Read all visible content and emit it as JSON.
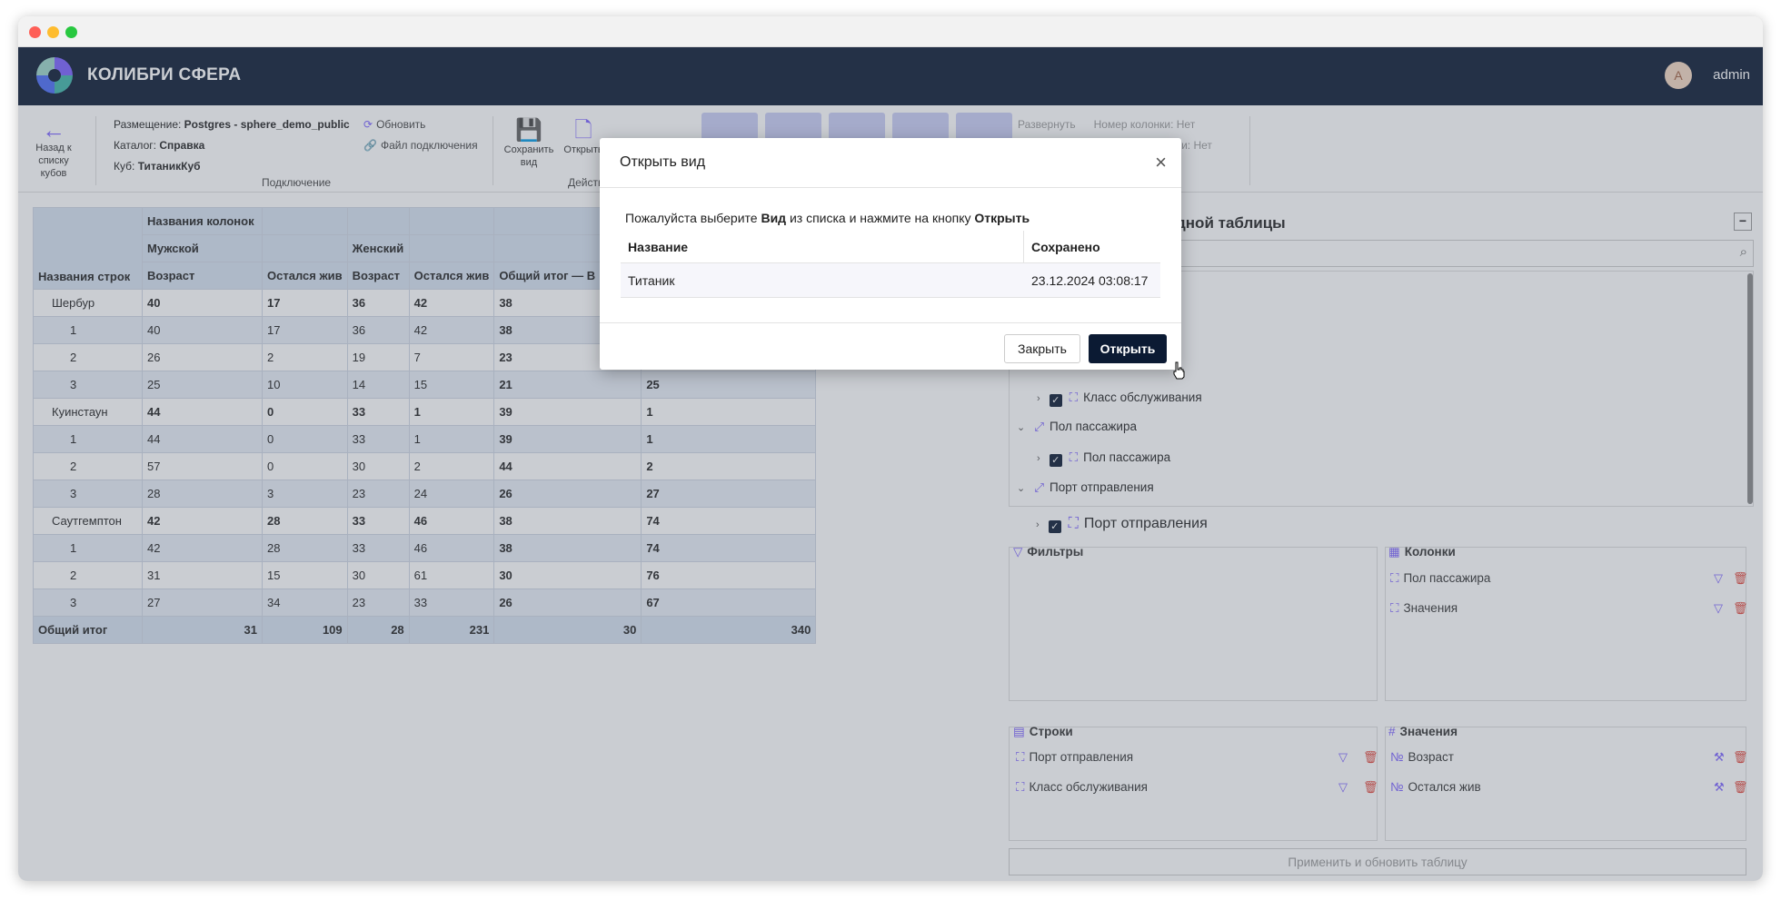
{
  "header": {
    "brand": "КОЛИБРИ СФЕРА",
    "avatar_letter": "A",
    "username": "admin"
  },
  "toolbar": {
    "back_label": "Назад к списку кубов",
    "connection": {
      "placement_label": "Размещение:",
      "placement_value": "Postgres - sphere_demo_public",
      "catalog_label": "Каталог:",
      "catalog_value": "Справка",
      "cube_label": "Куб:",
      "cube_value": "ТитаникКуб",
      "refresh": "Обновить",
      "conn_file": "Файл подключения",
      "group_label": "Подключение"
    },
    "save_view": "Сохранить вид",
    "open_view": "Открыть",
    "actions_group": "Действия",
    "expand": "Развернуть",
    "col_number": "Номер колонки: Нет",
    "row_number": "строки: Нет"
  },
  "pivot": {
    "col_names": "Названия колонок",
    "male": "Мужской",
    "female": "Женский",
    "row_names": "Названия строк",
    "age": "Возраст",
    "survived": "Остался жив",
    "grand_total_prefix": "Общий итог — В",
    "rows": [
      {
        "label": "Шербур",
        "level": 0,
        "v": [
          "40",
          "17",
          "36",
          "42",
          "38",
          ""
        ]
      },
      {
        "label": "1",
        "level": 1,
        "v": [
          "40",
          "17",
          "36",
          "42",
          "38",
          ""
        ]
      },
      {
        "label": "2",
        "level": 1,
        "v": [
          "26",
          "2",
          "19",
          "7",
          "23",
          ""
        ]
      },
      {
        "label": "3",
        "level": 1,
        "v": [
          "25",
          "10",
          "14",
          "15",
          "21",
          "25"
        ]
      },
      {
        "label": "Куинстаун",
        "level": 0,
        "v": [
          "44",
          "0",
          "33",
          "1",
          "39",
          "1"
        ]
      },
      {
        "label": "1",
        "level": 1,
        "v": [
          "44",
          "0",
          "33",
          "1",
          "39",
          "1"
        ]
      },
      {
        "label": "2",
        "level": 1,
        "v": [
          "57",
          "0",
          "30",
          "2",
          "44",
          "2"
        ]
      },
      {
        "label": "3",
        "level": 1,
        "v": [
          "28",
          "3",
          "23",
          "24",
          "26",
          "27"
        ]
      },
      {
        "label": "Саутгемптон",
        "level": 0,
        "v": [
          "42",
          "28",
          "33",
          "46",
          "38",
          "74"
        ]
      },
      {
        "label": "1",
        "level": 1,
        "v": [
          "42",
          "28",
          "33",
          "46",
          "38",
          "74"
        ]
      },
      {
        "label": "2",
        "level": 1,
        "v": [
          "31",
          "15",
          "30",
          "61",
          "30",
          "76"
        ]
      },
      {
        "label": "3",
        "level": 1,
        "v": [
          "27",
          "34",
          "23",
          "33",
          "26",
          "67"
        ]
      }
    ],
    "total_label": "Общий итог",
    "total": [
      "31",
      "109",
      "28",
      "231",
      "30",
      "340"
    ]
  },
  "fields_panel": {
    "title": "дной таблицы",
    "tree": [
      {
        "label": "Класс обслуживания",
        "kind": "leaf"
      },
      {
        "label": "Пол пассажира",
        "kind": "dim"
      },
      {
        "label": "Пол пассажира",
        "kind": "leaf"
      },
      {
        "label": "Порт отправления",
        "kind": "dim"
      },
      {
        "label": "Порт отправления",
        "kind": "leaf"
      }
    ],
    "filters_title": "Фильтры",
    "columns_title": "Колонки",
    "columns": [
      "Пол пассажира",
      "Значения"
    ],
    "rows_title": "Строки",
    "rows": [
      "Порт отправления",
      "Класс обслуживания"
    ],
    "values_title": "Значения",
    "values": [
      "Возраст",
      "Остался жив"
    ],
    "apply_button": "Применить и обновить таблицу"
  },
  "modal": {
    "title": "Открыть вид",
    "hint_prefix": "Пожалуйста выберите",
    "hint_bold1": "Вид",
    "hint_middle": "из списка и нажмите на кнопку",
    "hint_bold2": "Открыть",
    "col_name": "Название",
    "col_saved": "Сохранено",
    "views": [
      {
        "name": "Титаник",
        "saved": "23.12.2024 03:08:17"
      }
    ],
    "close_button": "Закрыть",
    "open_button": "Открыть"
  }
}
